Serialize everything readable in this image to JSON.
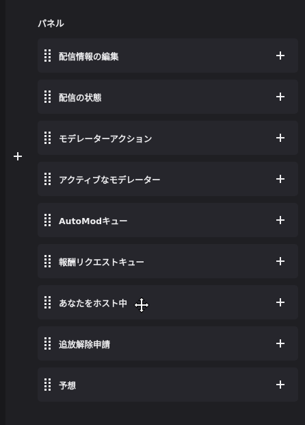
{
  "panel_section": {
    "title": "パネル",
    "items": [
      {
        "label": "配信情報の編集"
      },
      {
        "label": "配信の状態"
      },
      {
        "label": "モデレーターアクション"
      },
      {
        "label": "アクティブなモデレーター"
      },
      {
        "label": "AutoModキュー"
      },
      {
        "label": "報酬リクエストキュー"
      },
      {
        "label": "あなたをホスト中"
      },
      {
        "label": "追放解除申請"
      },
      {
        "label": "予想"
      }
    ]
  },
  "icons": {
    "add": "plus-icon",
    "drag": "drag-handle-icon",
    "cursor": "move-cursor-icon"
  },
  "colors": {
    "background": "#1f1f23",
    "item_background": "#26262c",
    "text": "#efeff1"
  }
}
